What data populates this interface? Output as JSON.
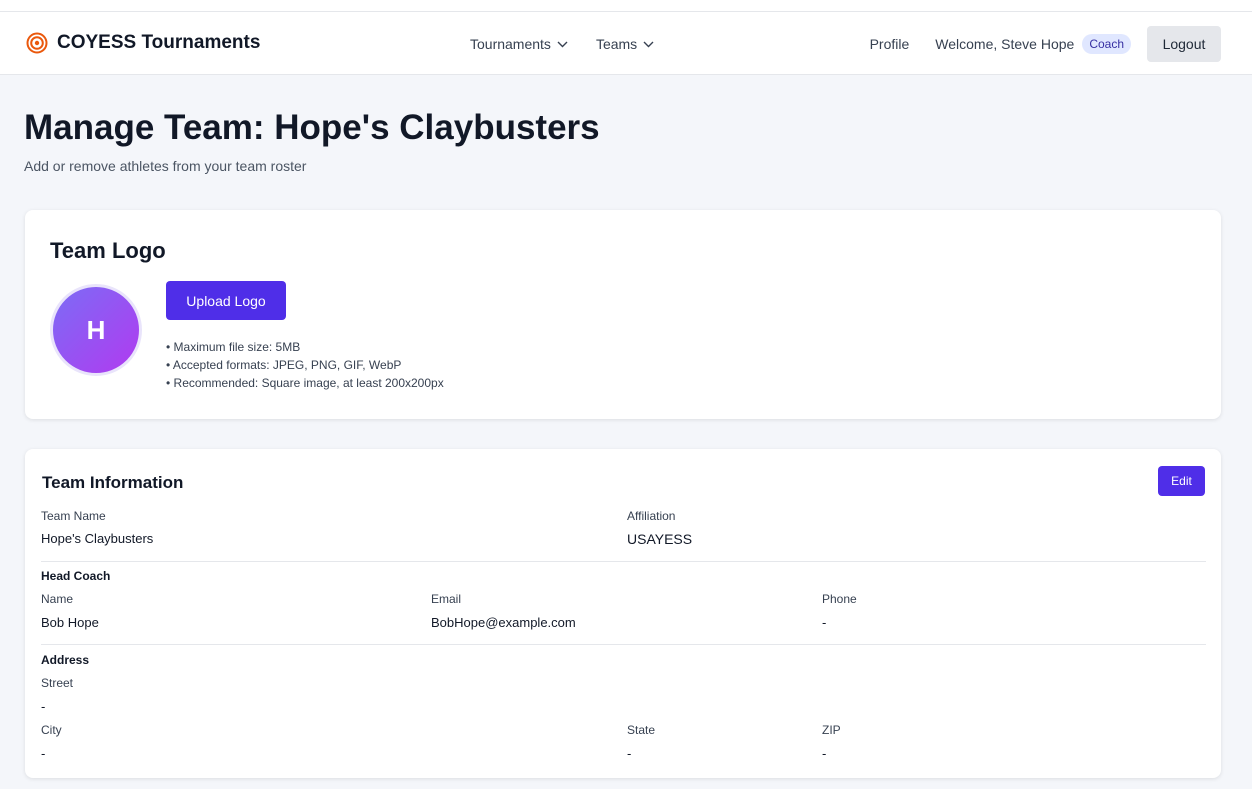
{
  "header": {
    "brand": "COYESS Tournaments",
    "nav": [
      {
        "label": "Tournaments"
      },
      {
        "label": "Teams"
      }
    ],
    "profile_label": "Profile",
    "welcome_text": "Welcome, Steve Hope",
    "role_badge": "Coach",
    "logout_label": "Logout"
  },
  "page": {
    "title": "Manage Team: Hope's Claybusters",
    "subtitle": "Add or remove athletes from your team roster"
  },
  "logo_card": {
    "title": "Team Logo",
    "avatar_initial": "H",
    "upload_label": "Upload Logo",
    "notes": [
      "• Maximum file size: 5MB",
      "• Accepted formats: JPEG, PNG, GIF, WebP",
      "• Recommended: Square image, at least 200x200px"
    ]
  },
  "team_info": {
    "title": "Team Information",
    "edit_label": "Edit",
    "team_name_label": "Team Name",
    "team_name": "Hope's Claybusters",
    "affiliation_label": "Affiliation",
    "affiliation": "USAYESS",
    "head_coach": {
      "heading": "Head Coach",
      "name_label": "Name",
      "name": "Bob Hope",
      "email_label": "Email",
      "email": "BobHope@example.com",
      "phone_label": "Phone",
      "phone": "-"
    },
    "address": {
      "heading": "Address",
      "street_label": "Street",
      "street": "-",
      "city_label": "City",
      "city": "-",
      "state_label": "State",
      "state": "-",
      "zip_label": "ZIP",
      "zip": "-"
    }
  },
  "colors": {
    "primary": "#4f2ee8",
    "brand_icon": "#ea580c",
    "badge_bg": "#e0e7ff",
    "page_bg": "#f4f6fa"
  }
}
